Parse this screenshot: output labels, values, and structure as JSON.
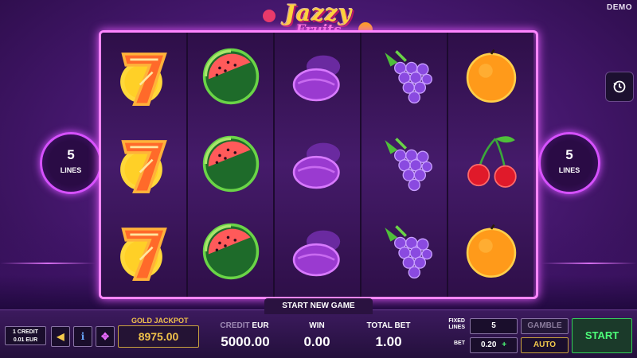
{
  "demo_label": "DEMO",
  "logo": {
    "line1": "Jazzy",
    "line2": "Fruits"
  },
  "reels": [
    [
      "seven",
      "seven",
      "seven"
    ],
    [
      "watermelon",
      "watermelon",
      "watermelon"
    ],
    [
      "plum",
      "plum",
      "plum"
    ],
    [
      "grapes",
      "grapes",
      "grapes"
    ],
    [
      "orange",
      "cherries",
      "orange"
    ]
  ],
  "lines_left": {
    "count": "5",
    "label": "LINES"
  },
  "lines_right": {
    "count": "5",
    "label": "LINES"
  },
  "history_icon": "history-icon",
  "message": "START NEW GAME",
  "credit_denom": {
    "line1": "1 CREDIT",
    "line2": "0.01 EUR"
  },
  "buttons": {
    "left_arrow_icon": "left-triangle-icon",
    "info_icon": "info-icon",
    "expand_icon": "expand-arrows-icon"
  },
  "jackpot": {
    "label": "GOLD JACKPOT",
    "value": "8975.00"
  },
  "credit": {
    "label_main": "CREDIT",
    "label_unit": " EUR",
    "value": "5000.00"
  },
  "win": {
    "label": "WIN",
    "value": "0.00"
  },
  "total_bet": {
    "label": "TOTAL BET",
    "value": "1.00"
  },
  "fixed_lines": {
    "label_line1": "FIXED",
    "label_line2": "LINES",
    "value": "5"
  },
  "bet": {
    "label": "BET",
    "value": "0.20",
    "stepper": "+"
  },
  "gamble_label": "GAMBLE",
  "auto_label": "AUTO",
  "start_label": "START",
  "colors": {
    "frame": "#ff86ff",
    "jackpot": "#f0c24a",
    "start": "#4dff79"
  }
}
